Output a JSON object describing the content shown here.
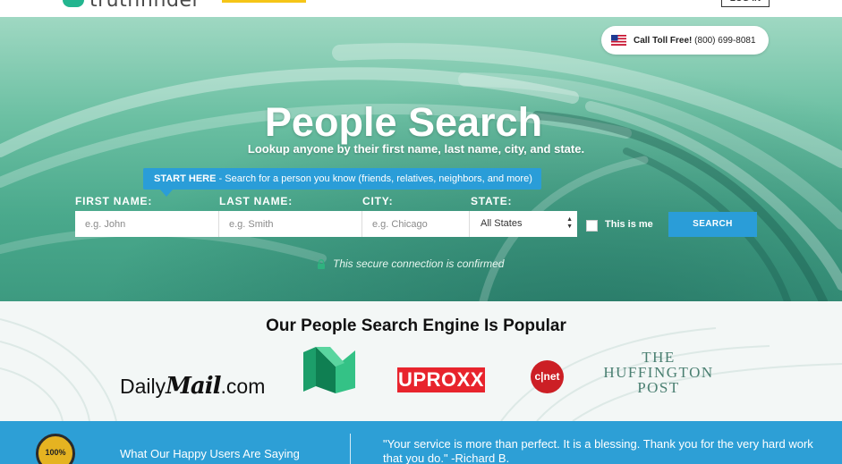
{
  "nav": {
    "logo_text": "truthfinder",
    "login_label": "LOG IN"
  },
  "header": {
    "call_label": "Call Toll Free!",
    "phone": "(800) 699-8081"
  },
  "hero": {
    "title": "People Search",
    "subtitle": "Lookup anyone by their first name, last name, city, and state.",
    "tip_strong": "START HERE",
    "tip_rest": " - Search for a person you know (friends, relatives, neighbors, and more)",
    "secure_text": "This secure connection is confirmed"
  },
  "form": {
    "first_name_label": "FIRST NAME:",
    "first_name_placeholder": "e.g. John",
    "last_name_label": "LAST NAME:",
    "last_name_placeholder": "e.g. Smith",
    "city_label": "CITY:",
    "city_placeholder": "e.g. Chicago",
    "state_label": "STATE:",
    "state_selected": "All States",
    "this_is_me_label": "This is me",
    "search_label": "SEARCH"
  },
  "popular": {
    "title": "Our People Search Engine Is Popular",
    "logos": {
      "dailymail_a": "Daily",
      "dailymail_b": "Mail",
      "dailymail_c": ".com",
      "uproxx": "UPROXX",
      "cnet": "c|net",
      "huff_line1": "THE",
      "huff_line2": "HUFFINGTON",
      "huff_line3": "POST"
    }
  },
  "testimonials": {
    "badge_text": "100%",
    "label": "What Our Happy Users Are Saying",
    "quote": "\"Your service is more than perfect. It is a blessing. Thank you for the very hard work that you do.\" -Richard B."
  },
  "colors": {
    "accent_blue": "#2a9dd8",
    "hero_teal": "#6cc0a3",
    "logo_green": "#23b58f",
    "uproxx_red": "#e8242d",
    "cnet_red": "#cc1f25"
  }
}
